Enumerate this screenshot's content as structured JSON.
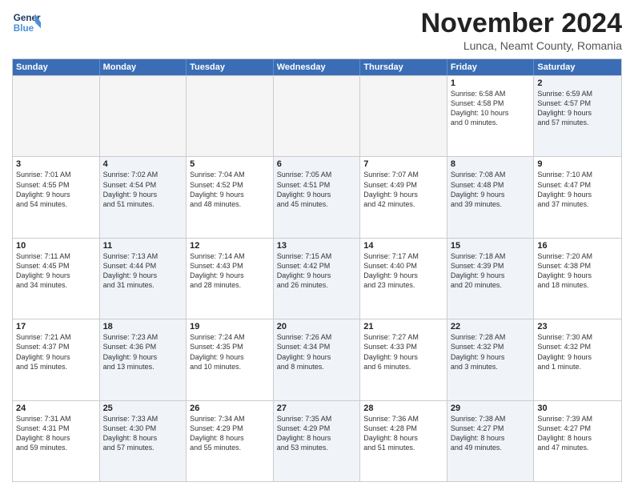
{
  "header": {
    "logo_line1": "General",
    "logo_line2": "Blue",
    "month_title": "November 2024",
    "location": "Lunca, Neamt County, Romania"
  },
  "weekdays": [
    "Sunday",
    "Monday",
    "Tuesday",
    "Wednesday",
    "Thursday",
    "Friday",
    "Saturday"
  ],
  "rows": [
    [
      {
        "day": "",
        "info": "",
        "empty": true
      },
      {
        "day": "",
        "info": "",
        "empty": true
      },
      {
        "day": "",
        "info": "",
        "empty": true
      },
      {
        "day": "",
        "info": "",
        "empty": true
      },
      {
        "day": "",
        "info": "",
        "empty": true
      },
      {
        "day": "1",
        "info": "Sunrise: 6:58 AM\nSunset: 4:58 PM\nDaylight: 10 hours\nand 0 minutes.",
        "empty": false
      },
      {
        "day": "2",
        "info": "Sunrise: 6:59 AM\nSunset: 4:57 PM\nDaylight: 9 hours\nand 57 minutes.",
        "empty": false,
        "alt": true
      }
    ],
    [
      {
        "day": "3",
        "info": "Sunrise: 7:01 AM\nSunset: 4:55 PM\nDaylight: 9 hours\nand 54 minutes.",
        "empty": false
      },
      {
        "day": "4",
        "info": "Sunrise: 7:02 AM\nSunset: 4:54 PM\nDaylight: 9 hours\nand 51 minutes.",
        "empty": false,
        "alt": true
      },
      {
        "day": "5",
        "info": "Sunrise: 7:04 AM\nSunset: 4:52 PM\nDaylight: 9 hours\nand 48 minutes.",
        "empty": false
      },
      {
        "day": "6",
        "info": "Sunrise: 7:05 AM\nSunset: 4:51 PM\nDaylight: 9 hours\nand 45 minutes.",
        "empty": false,
        "alt": true
      },
      {
        "day": "7",
        "info": "Sunrise: 7:07 AM\nSunset: 4:49 PM\nDaylight: 9 hours\nand 42 minutes.",
        "empty": false
      },
      {
        "day": "8",
        "info": "Sunrise: 7:08 AM\nSunset: 4:48 PM\nDaylight: 9 hours\nand 39 minutes.",
        "empty": false,
        "alt": true
      },
      {
        "day": "9",
        "info": "Sunrise: 7:10 AM\nSunset: 4:47 PM\nDaylight: 9 hours\nand 37 minutes.",
        "empty": false
      }
    ],
    [
      {
        "day": "10",
        "info": "Sunrise: 7:11 AM\nSunset: 4:45 PM\nDaylight: 9 hours\nand 34 minutes.",
        "empty": false
      },
      {
        "day": "11",
        "info": "Sunrise: 7:13 AM\nSunset: 4:44 PM\nDaylight: 9 hours\nand 31 minutes.",
        "empty": false,
        "alt": true
      },
      {
        "day": "12",
        "info": "Sunrise: 7:14 AM\nSunset: 4:43 PM\nDaylight: 9 hours\nand 28 minutes.",
        "empty": false
      },
      {
        "day": "13",
        "info": "Sunrise: 7:15 AM\nSunset: 4:42 PM\nDaylight: 9 hours\nand 26 minutes.",
        "empty": false,
        "alt": true
      },
      {
        "day": "14",
        "info": "Sunrise: 7:17 AM\nSunset: 4:40 PM\nDaylight: 9 hours\nand 23 minutes.",
        "empty": false
      },
      {
        "day": "15",
        "info": "Sunrise: 7:18 AM\nSunset: 4:39 PM\nDaylight: 9 hours\nand 20 minutes.",
        "empty": false,
        "alt": true
      },
      {
        "day": "16",
        "info": "Sunrise: 7:20 AM\nSunset: 4:38 PM\nDaylight: 9 hours\nand 18 minutes.",
        "empty": false
      }
    ],
    [
      {
        "day": "17",
        "info": "Sunrise: 7:21 AM\nSunset: 4:37 PM\nDaylight: 9 hours\nand 15 minutes.",
        "empty": false
      },
      {
        "day": "18",
        "info": "Sunrise: 7:23 AM\nSunset: 4:36 PM\nDaylight: 9 hours\nand 13 minutes.",
        "empty": false,
        "alt": true
      },
      {
        "day": "19",
        "info": "Sunrise: 7:24 AM\nSunset: 4:35 PM\nDaylight: 9 hours\nand 10 minutes.",
        "empty": false
      },
      {
        "day": "20",
        "info": "Sunrise: 7:26 AM\nSunset: 4:34 PM\nDaylight: 9 hours\nand 8 minutes.",
        "empty": false,
        "alt": true
      },
      {
        "day": "21",
        "info": "Sunrise: 7:27 AM\nSunset: 4:33 PM\nDaylight: 9 hours\nand 6 minutes.",
        "empty": false
      },
      {
        "day": "22",
        "info": "Sunrise: 7:28 AM\nSunset: 4:32 PM\nDaylight: 9 hours\nand 3 minutes.",
        "empty": false,
        "alt": true
      },
      {
        "day": "23",
        "info": "Sunrise: 7:30 AM\nSunset: 4:32 PM\nDaylight: 9 hours\nand 1 minute.",
        "empty": false
      }
    ],
    [
      {
        "day": "24",
        "info": "Sunrise: 7:31 AM\nSunset: 4:31 PM\nDaylight: 8 hours\nand 59 minutes.",
        "empty": false
      },
      {
        "day": "25",
        "info": "Sunrise: 7:33 AM\nSunset: 4:30 PM\nDaylight: 8 hours\nand 57 minutes.",
        "empty": false,
        "alt": true
      },
      {
        "day": "26",
        "info": "Sunrise: 7:34 AM\nSunset: 4:29 PM\nDaylight: 8 hours\nand 55 minutes.",
        "empty": false
      },
      {
        "day": "27",
        "info": "Sunrise: 7:35 AM\nSunset: 4:29 PM\nDaylight: 8 hours\nand 53 minutes.",
        "empty": false,
        "alt": true
      },
      {
        "day": "28",
        "info": "Sunrise: 7:36 AM\nSunset: 4:28 PM\nDaylight: 8 hours\nand 51 minutes.",
        "empty": false
      },
      {
        "day": "29",
        "info": "Sunrise: 7:38 AM\nSunset: 4:27 PM\nDaylight: 8 hours\nand 49 minutes.",
        "empty": false,
        "alt": true
      },
      {
        "day": "30",
        "info": "Sunrise: 7:39 AM\nSunset: 4:27 PM\nDaylight: 8 hours\nand 47 minutes.",
        "empty": false
      }
    ]
  ]
}
